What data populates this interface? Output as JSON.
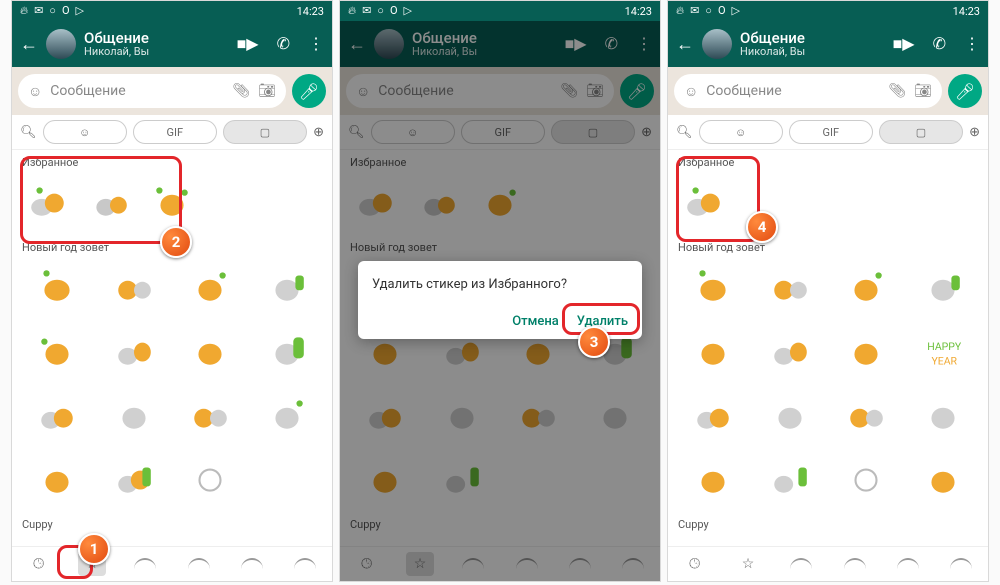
{
  "status": {
    "time": "14:23"
  },
  "header": {
    "title": "Общение",
    "sub": "Николай, Вы"
  },
  "input": {
    "placeholder": "Сообщение"
  },
  "tabs": {
    "gif": "GIF"
  },
  "sections": {
    "favorites": "Избранное",
    "pack1": "Новый год зовет",
    "pack2": "Cuppy"
  },
  "dialog": {
    "text": "Удалить стикер из Избранного?",
    "cancel": "Отмена",
    "confirm": "Удалить"
  },
  "callouts": {
    "c1": "1",
    "c2": "2",
    "c3": "3",
    "c4": "4"
  }
}
